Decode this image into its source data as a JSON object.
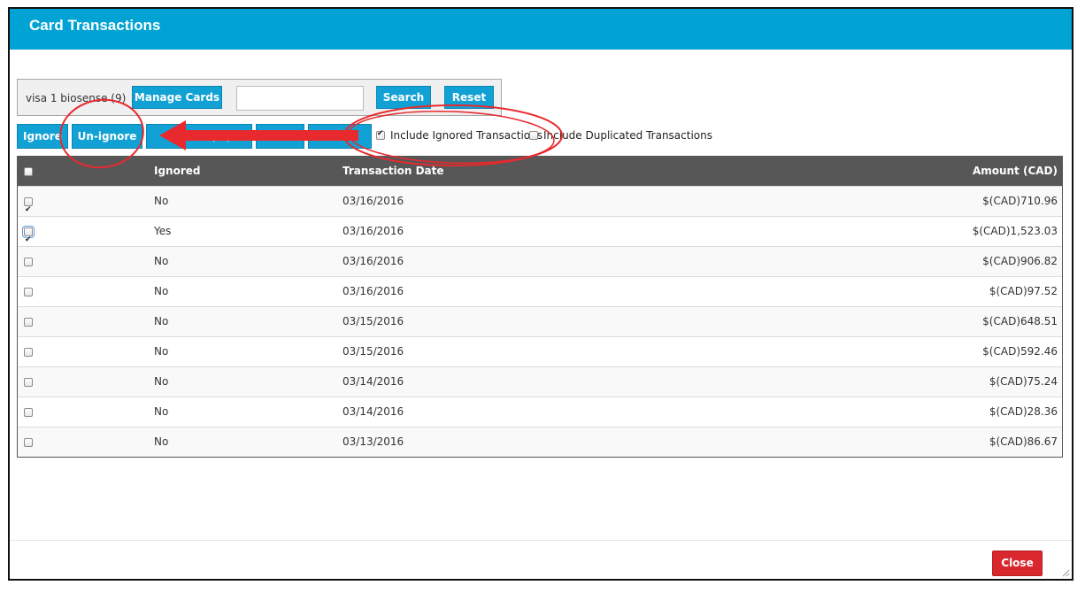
{
  "window": {
    "title": "Card Transactions"
  },
  "filter": {
    "card_label": "visa 1 biosense (9)",
    "manage_cards": "Manage Cards",
    "search_value": "",
    "search_button": "Search",
    "reset_button": "Reset"
  },
  "actions": {
    "ignore": "Ignore",
    "unignore": "Un-ignore",
    "btn3": "Re… … (…)",
    "btn4": "…",
    "btn5": "…a…",
    "include_ignored": "Include Ignored Transactions",
    "include_ignored_checked": true,
    "include_duplicated": "Include Duplicated Transactions",
    "include_duplicated_checked": false
  },
  "table": {
    "headers": {
      "ignored": "Ignored",
      "date": "Transaction Date",
      "amount": "Amount (CAD)"
    },
    "rows": [
      {
        "checked": true,
        "ignored": "No",
        "date": "03/16/2016",
        "amount": "$(CAD)710.96"
      },
      {
        "checked": true,
        "ignored": "Yes",
        "date": "03/16/2016",
        "amount": "$(CAD)1,523.03",
        "focused": true
      },
      {
        "checked": false,
        "ignored": "No",
        "date": "03/16/2016",
        "amount": "$(CAD)906.82"
      },
      {
        "checked": false,
        "ignored": "No",
        "date": "03/16/2016",
        "amount": "$(CAD)97.52"
      },
      {
        "checked": false,
        "ignored": "No",
        "date": "03/15/2016",
        "amount": "$(CAD)648.51"
      },
      {
        "checked": false,
        "ignored": "No",
        "date": "03/15/2016",
        "amount": "$(CAD)592.46"
      },
      {
        "checked": false,
        "ignored": "No",
        "date": "03/14/2016",
        "amount": "$(CAD)75.24"
      },
      {
        "checked": false,
        "ignored": "No",
        "date": "03/14/2016",
        "amount": "$(CAD)28.36"
      },
      {
        "checked": false,
        "ignored": "No",
        "date": "03/13/2016",
        "amount": "$(CAD)86.67"
      }
    ]
  },
  "footer": {
    "close": "Close"
  },
  "colors": {
    "header": "#00a3d3",
    "button": "#12a1d4",
    "close": "#d9272e",
    "annotation": "#e8292e"
  }
}
